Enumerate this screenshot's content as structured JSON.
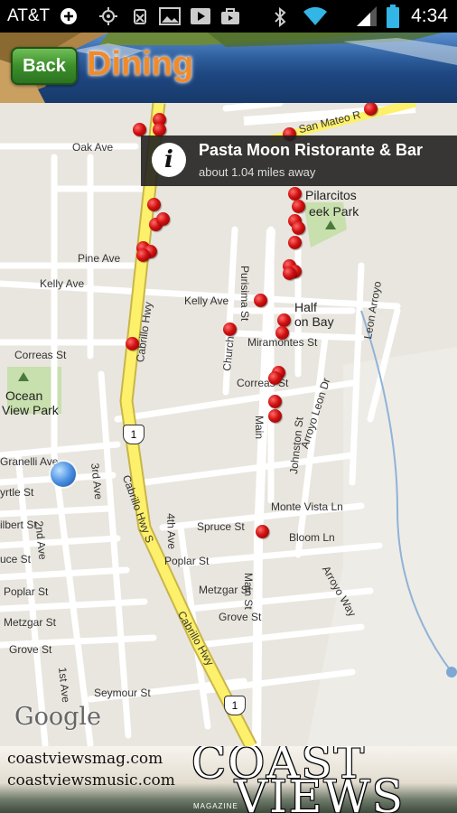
{
  "status_bar": {
    "carrier": "AT&T",
    "time": "4:34",
    "icons": [
      "plus-circle-icon",
      "gps-icon",
      "no-sim-icon",
      "image-icon",
      "video-icon",
      "bag-icon",
      "bluetooth-icon",
      "wifi-icon",
      "signal-icon",
      "battery-icon"
    ]
  },
  "header": {
    "back_label": "Back",
    "title": "Dining"
  },
  "map": {
    "info_window": {
      "name": "Pasta Moon Ristorante & Bar",
      "distance": "about 1.04 miles away"
    },
    "attribution": "Google",
    "labels": {
      "oak_ave": "Oak Ave",
      "pine_ave": "Pine Ave",
      "kelly_ave_left": "Kelly Ave",
      "kelly_ave_right": "Kelly Ave",
      "correas_left": "Correas St",
      "correas_right": "Correas St",
      "ocean": "Ocean",
      "view_park": "View Park",
      "granelli": "Granelli Ave",
      "myrtle": "yrtle St",
      "filbert": "ilbert St",
      "spruce_left": "uce St",
      "spruce_right": "Spruce St",
      "poplar_left": "Poplar St",
      "poplar_right": "Poplar St",
      "metzgar_left": "Metzgar St",
      "metzgar_right": "Metzgar St",
      "grove_left": "Grove St",
      "grove_right": "Grove St",
      "seymour": "Seymour St",
      "half": "Half",
      "moon_bay": "on Bay",
      "miramontes": "Miramontes St",
      "pilarcitos": "Pilarcitos",
      "creek_park": "eek Park",
      "san_mateo": "San Mateo R",
      "monte_vista": "Monte Vista Ln",
      "bloom": "Bloom Ln",
      "arroyo_leon": "Arroyo Leon Dr",
      "johnston": "Johnston St",
      "main": "Main St",
      "main_upper": "Main",
      "purisima": "Purisima St",
      "church": "Church",
      "fourth_ave": "4th Ave",
      "third_ave": "3rd Ave",
      "second_ave": "2nd Ave",
      "first_ave": "1st Ave",
      "cabrillo_hwy": "Cabrillo Hwy",
      "cabrillo_hwy_s": "Cabrillo Hwy S",
      "cabrillo_hwy_2": "Cabrillo Hwy",
      "leon_arroyo": "Leon Arroyo",
      "arroyo_way": "Arroyo Way",
      "route_1a": "1",
      "route_1b": "1"
    }
  },
  "footer": {
    "url1": "coastviewsmag.com",
    "url2": "coastviewsmusic.com",
    "brand_line1": "COAST",
    "brand_line2": "VIEWS",
    "brand_sub": "MAGAZINE"
  }
}
